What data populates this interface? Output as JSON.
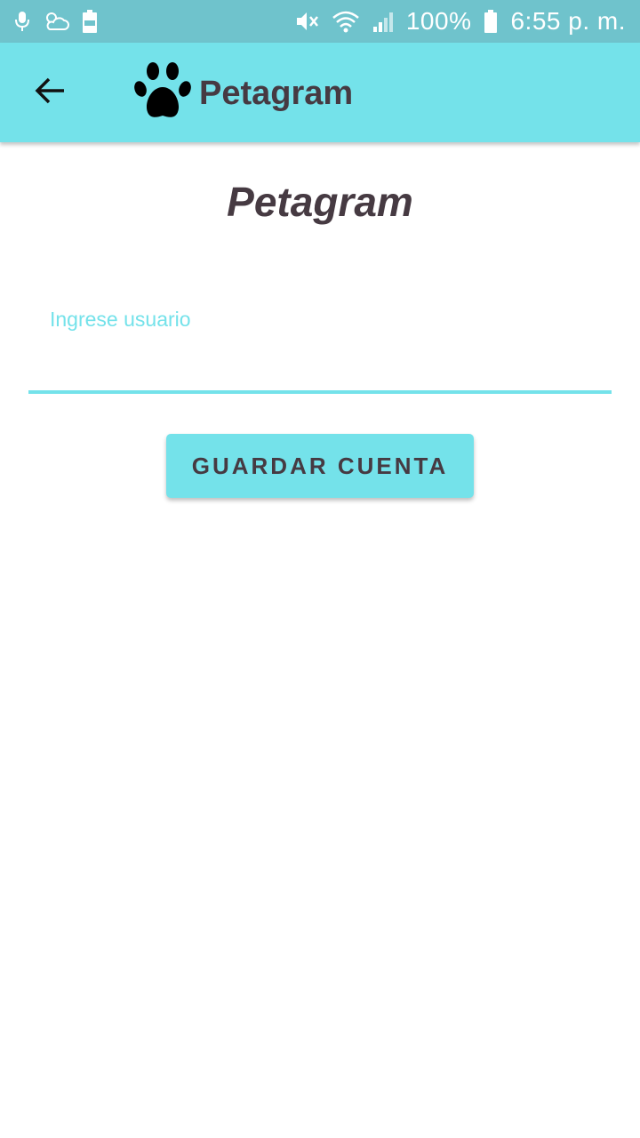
{
  "status_bar": {
    "background": "#6fc3cc",
    "left_icons": [
      "microphone-icon",
      "weather-cloud-icon",
      "battery-100-notification-icon"
    ],
    "right_icons": [
      "vibrate-mute-icon",
      "wifi-icon",
      "signal-icon",
      "battery-icon"
    ],
    "battery_percent": "100%",
    "time": "6:55 p. m."
  },
  "app_bar": {
    "background": "#74e2ea",
    "back_icon": "arrow-back-icon",
    "logo_icon": "paw-icon",
    "title": "Petagram"
  },
  "main": {
    "heading": "Petagram",
    "username_field": {
      "label": "Ingrese usuario",
      "value": "",
      "accent_color": "#74e2ea"
    },
    "save_button_label": "GUARDAR CUENTA"
  },
  "colors": {
    "accent": "#74e2ea",
    "text_primary": "#463a42"
  }
}
